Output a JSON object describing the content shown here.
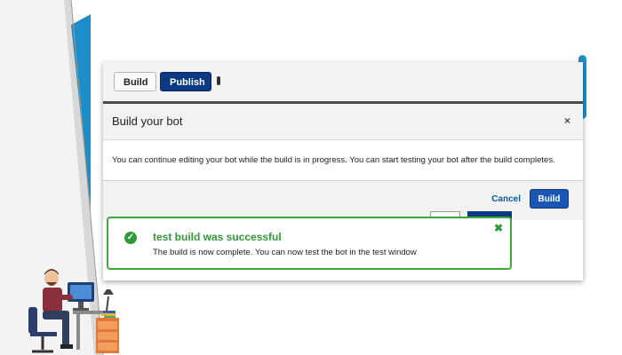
{
  "toolbar": {
    "build_label": "Build",
    "publish_label": "Publish"
  },
  "modal": {
    "title": "Build your bot",
    "close_glyph": "×",
    "message": "You can continue editing your bot while the build is in progress. You can start testing your bot after the build completes.",
    "cancel_label": "Cancel",
    "build_label": "Build"
  },
  "toast": {
    "check_glyph": "✓",
    "title": "test build was successful",
    "message": "The build is now complete. You can now test the bot in the test window",
    "close_glyph": "✖"
  },
  "colors": {
    "accent_blue": "#1d8dc9",
    "publish_navy": "#0c3a82",
    "success_green": "#2e9a36"
  }
}
